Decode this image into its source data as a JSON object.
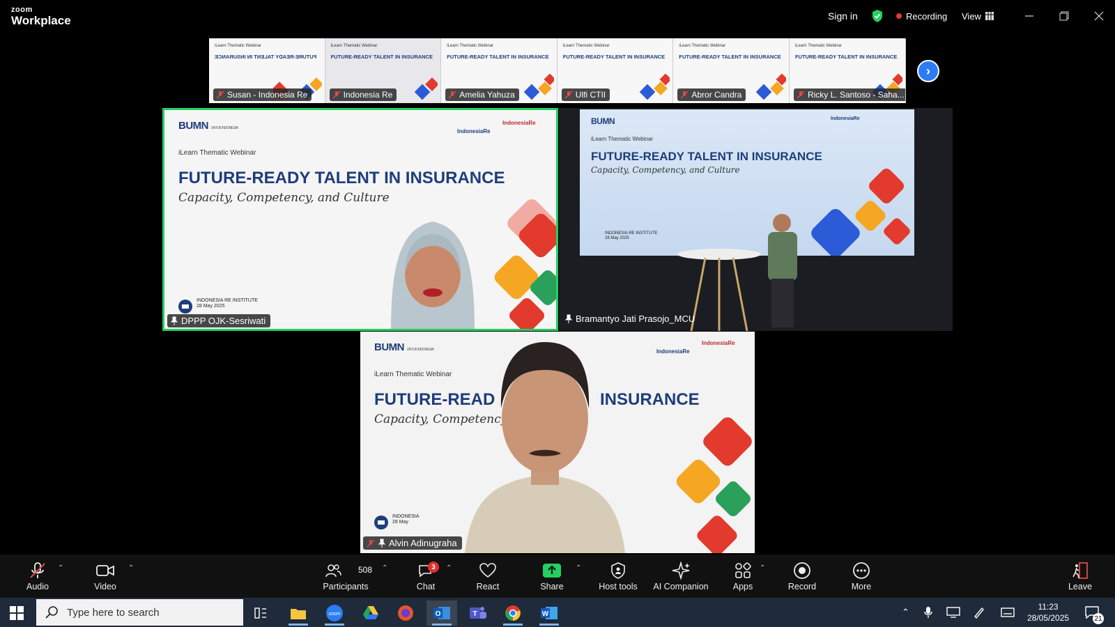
{
  "app": {
    "brand_top": "zoom",
    "brand_bottom": "Workplace"
  },
  "topbar": {
    "sign_in": "Sign in",
    "recording": "Recording",
    "view": "View"
  },
  "thumbnails": [
    {
      "name": "Susan - Indonesia Re"
    },
    {
      "name": "Indonesia Re"
    },
    {
      "name": "Amelia Yahuza"
    },
    {
      "name": "Ulfi CTII"
    },
    {
      "name": "Abror Candra"
    },
    {
      "name": "Ricky L. Santoso - Saha..."
    }
  ],
  "slide": {
    "org": "BUMN",
    "org_small": "UNTUK INDONESIA",
    "label": "iLearn Thematic Webinar",
    "title": "FUTURE-READY TALENT IN INSURANCE",
    "subtitle": "Capacity, Competency, and Culture",
    "brand1": "IndonesiaRe",
    "brand2": "IndonesiaRe",
    "institute": "INDONESIA RE INSTITUTE",
    "date": "28 May 2025"
  },
  "tiles": {
    "t1_name": "DPPP OJK-Sesriwati",
    "t2_name": "Bramantyo Jati Prasojo_MCU",
    "t3_name": "Alvin Adinugraha",
    "t3_title_left": "FUTURE-READ",
    "t3_title_right": "INSURANCE",
    "t3_subtitle": "Capacity, Competency, and C",
    "t3_institute": "INDONESIA",
    "t3_date": "28 May"
  },
  "toolbar": {
    "audio": "Audio",
    "video": "Video",
    "participants": "Participants",
    "participants_count": "508",
    "chat": "Chat",
    "chat_badge": "3",
    "react": "React",
    "share": "Share",
    "host_tools": "Host tools",
    "ai_companion": "AI Companion",
    "apps": "Apps",
    "record": "Record",
    "more": "More",
    "leave": "Leave"
  },
  "taskbar": {
    "search_placeholder": "Type here to search",
    "time": "11:23",
    "date": "28/05/2025",
    "notifications": "21"
  },
  "colors": {
    "active_border": "#23d160",
    "share_green": "#23d160",
    "accent_blue": "#2b7cf6",
    "record_red": "#e03a3a"
  }
}
